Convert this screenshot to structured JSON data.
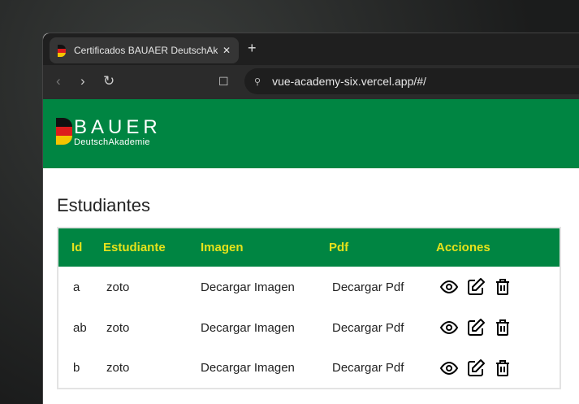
{
  "browser": {
    "tab_title": "Certificados BAUAER DeutschAkademie",
    "url": "vue-academy-six.vercel.app/#/"
  },
  "header": {
    "brand": "BAUER",
    "sub": "DeutschAkademie"
  },
  "page": {
    "title": "Estudiantes"
  },
  "table": {
    "columns": [
      "Id",
      "Estudiante",
      "Imagen",
      "Pdf",
      "Acciones"
    ],
    "rows": [
      {
        "id": "a",
        "estudiante": "zoto",
        "imagen": "Decargar Imagen",
        "pdf": "Decargar Pdf"
      },
      {
        "id": "ab",
        "estudiante": "zoto",
        "imagen": "Decargar Imagen",
        "pdf": "Decargar Pdf"
      },
      {
        "id": "b",
        "estudiante": "zoto",
        "imagen": "Decargar Imagen",
        "pdf": "Decargar Pdf"
      }
    ]
  }
}
